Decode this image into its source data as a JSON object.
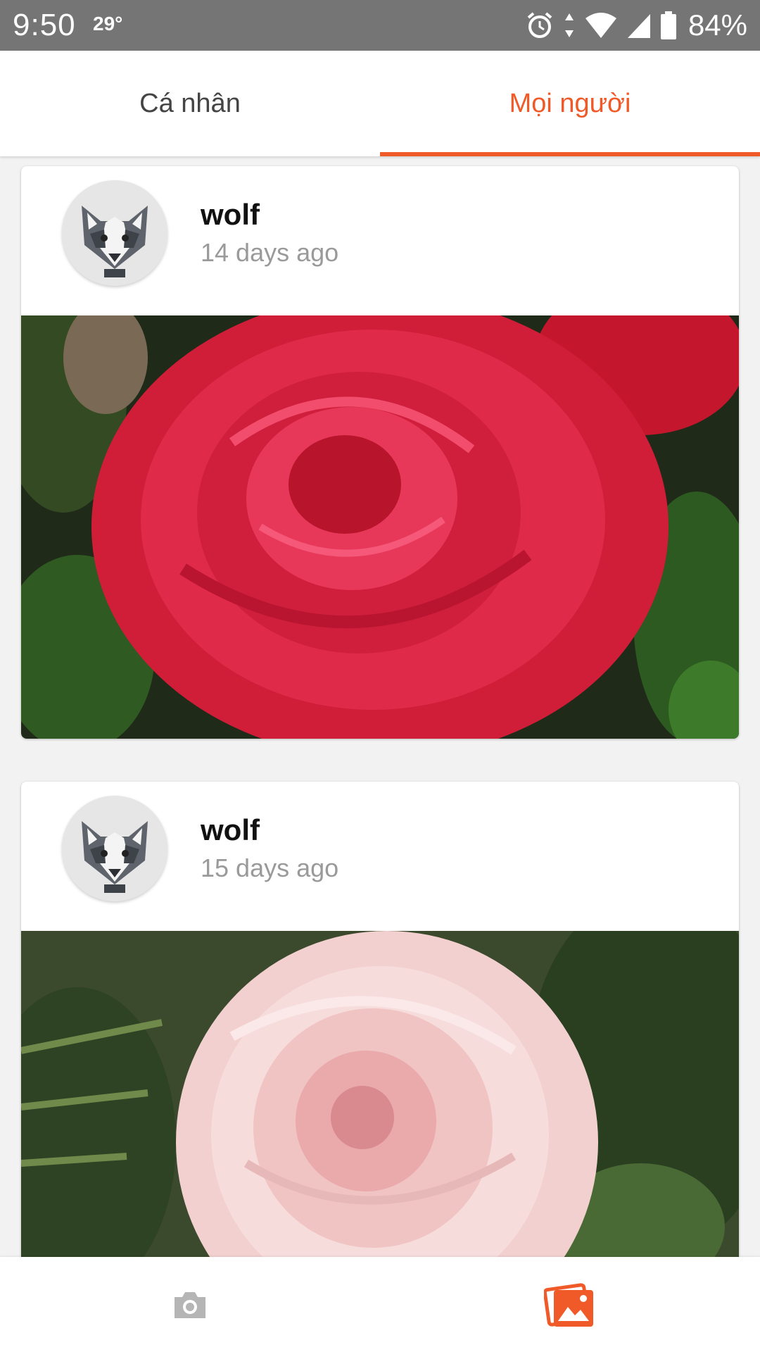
{
  "status_bar": {
    "time": "9:50",
    "temperature": "29°",
    "battery": "84%",
    "icons": [
      "alarm-icon",
      "data-arrows-icon",
      "wifi-icon",
      "signal-icon",
      "battery-icon"
    ]
  },
  "tabs": [
    {
      "label": "Cá nhân",
      "active": false
    },
    {
      "label": "Mọi người",
      "active": true
    }
  ],
  "accent_color": "#f05a28",
  "posts": [
    {
      "username": "wolf",
      "time": "14 days ago",
      "avatar": "wolf-avatar-icon",
      "photo": "red-rose-photo"
    },
    {
      "username": "wolf",
      "time": "15 days ago",
      "avatar": "wolf-avatar-icon",
      "photo": "pink-rose-photo"
    }
  ],
  "bottom_nav": [
    {
      "icon": "camera-icon",
      "active": false
    },
    {
      "icon": "gallery-icon",
      "active": true
    }
  ]
}
